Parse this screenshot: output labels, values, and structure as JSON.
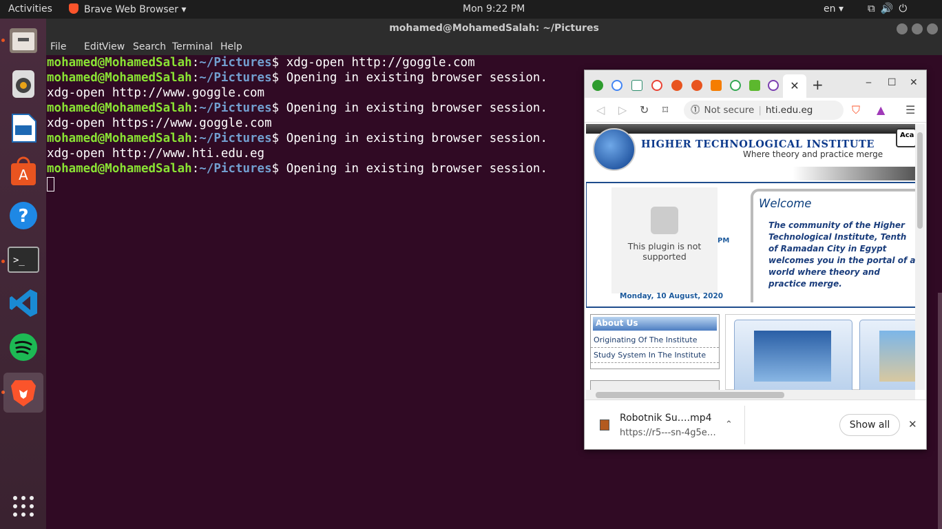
{
  "topbar": {
    "activities": "Activities",
    "app_name": "Brave Web Browser",
    "app_caret": "▾",
    "clock": "Mon  9:22 PM",
    "lang": "en",
    "lang_caret": "▾",
    "tray_icons": [
      "network-icon",
      "volume-icon",
      "power-icon"
    ]
  },
  "dock": {
    "items": [
      "files",
      "rhythmbox",
      "libreoffice-impress",
      "ubuntu-software",
      "help",
      "terminal",
      "vscode",
      "spotify",
      "brave"
    ],
    "active": "brave",
    "apps_grid_label": "⋮⋮⋮"
  },
  "terminal": {
    "title": "mohamed@MohamedSalah: ~/Pictures",
    "menu": [
      "File",
      "Edit",
      "View",
      "Search",
      "Terminal",
      "Help"
    ],
    "prompt_user": "mohamed@MohamedSalah",
    "prompt_path": "~/Pictures",
    "lines": [
      {
        "prompt": true,
        "cmd": "$ xdg-open http://goggle.com"
      },
      {
        "prompt": true,
        "cmd": "$ Opening in existing browser session."
      },
      {
        "prompt": false,
        "cmd": "xdg-open http://www.goggle.com"
      },
      {
        "prompt": true,
        "cmd": "$ Opening in existing browser session."
      },
      {
        "prompt": false,
        "cmd": "xdg-open https://www.goggle.com"
      },
      {
        "prompt": true,
        "cmd": "$ Opening in existing browser session."
      },
      {
        "prompt": false,
        "cmd": "xdg-open http://www.hti.edu.eg"
      },
      {
        "prompt": true,
        "cmd": "$ Opening in existing browser session."
      }
    ]
  },
  "browser": {
    "active_tab_close": "✕",
    "new_tab": "+",
    "window_controls": [
      "‒",
      "☐",
      "✕"
    ],
    "not_secure": "Not secure",
    "url": "hti.edu.eg",
    "page": {
      "institute_name": "HIGHER TECHNOLOGICAL INSTITUTE",
      "tagline": "Where theory and practice merge",
      "aca_tab": "Aca",
      "plugin_text": "This plugin is not supported",
      "pm": "PM",
      "date": "Monday, 10 August, 2020",
      "welcome_title": "Welcome",
      "welcome_text": "The community of the Higher Technological Institute, Tenth of Ramadan City in Egypt welcomes you in the portal of a world where theory and practice merge.",
      "about_title": "About Us",
      "about_items": [
        "Originating Of The Institute",
        "Study System In The Institute"
      ]
    },
    "download": {
      "file_name": "Robotnik Su….mp4",
      "file_url": "https://r5---sn-4g5e…",
      "chevron": "⌃",
      "show_all": "Show all",
      "close": "✕"
    }
  },
  "colors": {
    "terminal_bg": "#300a24",
    "prompt_user": "#8ae234",
    "prompt_path": "#729fcf",
    "accent": "#e95420"
  }
}
